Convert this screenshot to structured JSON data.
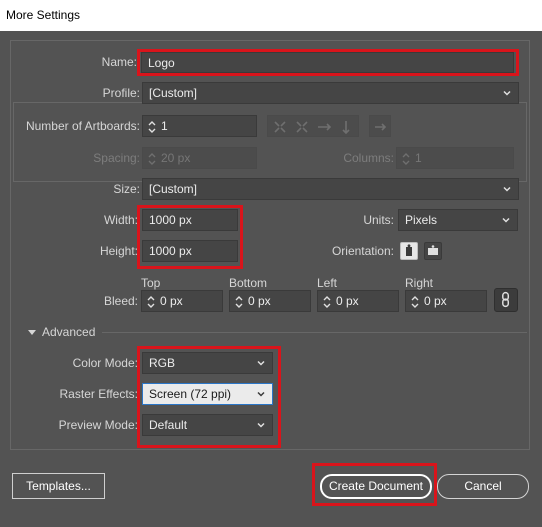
{
  "window": {
    "title": "More Settings"
  },
  "name": {
    "label": "Name:",
    "value": "Logo"
  },
  "profile": {
    "label": "Profile:",
    "value": "[Custom]"
  },
  "artboards": {
    "label": "Number of Artboards:",
    "value": "1"
  },
  "spacing": {
    "label": "Spacing:",
    "value": "20 px"
  },
  "columns": {
    "label": "Columns:",
    "value": "1"
  },
  "size": {
    "label": "Size:",
    "value": "[Custom]"
  },
  "width": {
    "label": "Width:",
    "value": "1000 px"
  },
  "height": {
    "label": "Height:",
    "value": "1000 px"
  },
  "units": {
    "label": "Units:",
    "value": "Pixels"
  },
  "orientation": {
    "label": "Orientation:"
  },
  "bleed": {
    "label": "Bleed:",
    "top": {
      "label": "Top",
      "value": "0 px"
    },
    "bottom": {
      "label": "Bottom",
      "value": "0 px"
    },
    "left": {
      "label": "Left",
      "value": "0 px"
    },
    "right": {
      "label": "Right",
      "value": "0 px"
    }
  },
  "advanced": {
    "label": "Advanced"
  },
  "color_mode": {
    "label": "Color Mode:",
    "value": "RGB"
  },
  "raster_effects": {
    "label": "Raster Effects:",
    "value": "Screen (72 ppi)"
  },
  "preview_mode": {
    "label": "Preview Mode:",
    "value": "Default"
  },
  "buttons": {
    "templates": "Templates...",
    "create": "Create Document",
    "cancel": "Cancel"
  },
  "colors": {
    "background": "#535353",
    "highlight": "#d9141b",
    "field": "#454545",
    "focus": "#2a76c8"
  }
}
